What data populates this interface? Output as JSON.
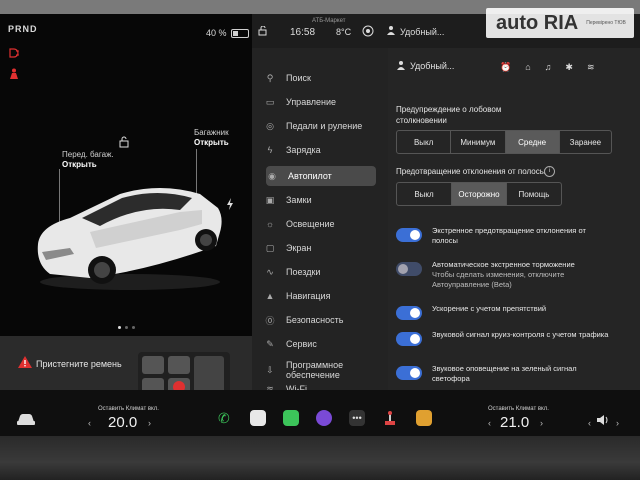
{
  "status": {
    "gear": "PRND",
    "battery_pct": "40 %",
    "battery_level": 0.4,
    "time": "16:58",
    "temp": "8°C",
    "network": "АТБ-Маркет",
    "profile_label": "Удобный..."
  },
  "car": {
    "front_trunk_label": "Перед. багаж.",
    "front_trunk_state": "Открыть",
    "trunk_label": "Багажник",
    "trunk_state": "Открыть",
    "belt_warning": "Пристегните ремень"
  },
  "nav": {
    "items": [
      {
        "label": "Поиск",
        "icon": "search-icon"
      },
      {
        "label": "Управление",
        "icon": "car-icon"
      },
      {
        "label": "Педали и руление",
        "icon": "steering-icon"
      },
      {
        "label": "Зарядка",
        "icon": "bolt-icon"
      },
      {
        "label": "Автопилот",
        "icon": "wheel-icon"
      },
      {
        "label": "Замки",
        "icon": "lock-icon"
      },
      {
        "label": "Освещение",
        "icon": "sun-icon"
      },
      {
        "label": "Экран",
        "icon": "screen-icon"
      },
      {
        "label": "Поездки",
        "icon": "trips-icon"
      },
      {
        "label": "Навигация",
        "icon": "navigation-icon"
      },
      {
        "label": "Безопасность",
        "icon": "shield-icon"
      },
      {
        "label": "Сервис",
        "icon": "wrench-icon"
      },
      {
        "label": "Программное обеспечение",
        "icon": "download-icon"
      },
      {
        "label": "Wi-Fi",
        "icon": "wifi-icon"
      }
    ],
    "active_index": 4
  },
  "content": {
    "profile": "Удобный...",
    "collision_title": "Предупреждение о лобовом столкновении",
    "collision_options": [
      "Выкл",
      "Минимум",
      "Средне",
      "Заранее"
    ],
    "collision_selected": "Средне",
    "lane_title": "Предотвращение отклонения от полосы",
    "lane_options": [
      "Выкл",
      "Осторожно",
      "Помощь"
    ],
    "lane_selected": "Осторожно",
    "toggles": [
      {
        "label": "Экстренное предотвращение отклонения от полосы",
        "sub": "",
        "on": true
      },
      {
        "label": "Автоматическое экстренное торможение",
        "sub": "Чтобы сделать изменения, отключите Автоуправление (Beta)",
        "on": false
      },
      {
        "label": "Ускорение с учетом препятствий",
        "sub": "",
        "on": true
      },
      {
        "label": "Звуковой сигнал круиз-контроля с учетом трафика",
        "sub": "",
        "on": true
      },
      {
        "label": "Звуковое оповещение на зеленый сигнал светофора",
        "sub": "",
        "on": true
      }
    ]
  },
  "dock": {
    "left_hint": "Оставить Климат вкл.",
    "left_temp": "20.0",
    "right_hint": "Оставить Климат вкл.",
    "right_temp": "21.0"
  },
  "watermark": {
    "brand": "auto RIA",
    "sub": "Перевірено ТЮВ"
  }
}
